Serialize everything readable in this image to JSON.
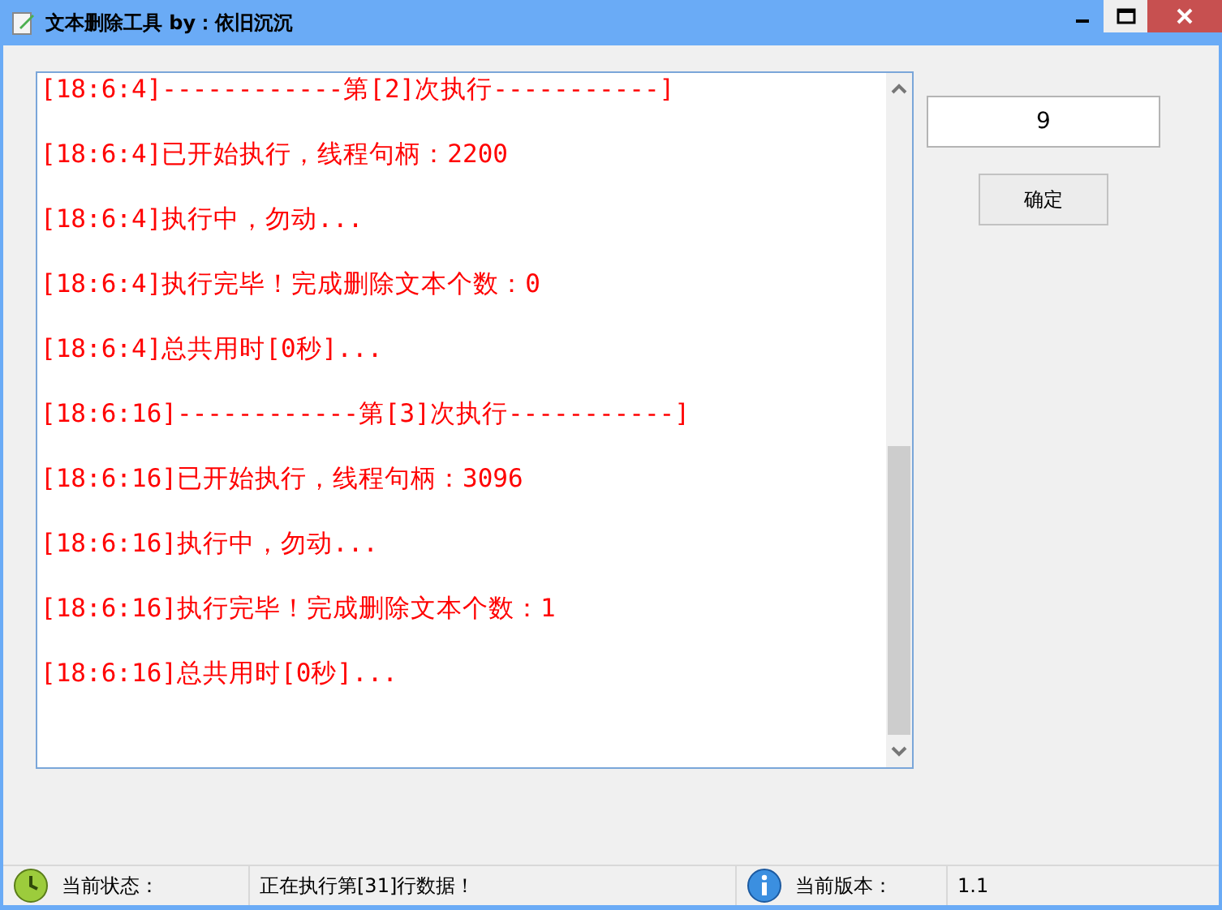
{
  "window": {
    "title": "文本删除工具 by：依旧沉沉"
  },
  "log": {
    "lines": [
      "[18:6:4]------------第[2]次执行-----------]",
      "[18:6:4]已开始执行，线程句柄：2200",
      "[18:6:4]执行中，勿动...",
      "[18:6:4]执行完毕！完成删除文本个数：0",
      "[18:6:4]总共用时[0秒]...",
      "[18:6:16]------------第[3]次执行-----------]",
      "[18:6:16]已开始执行，线程句柄：3096",
      "[18:6:16]执行中，勿动...",
      "[18:6:16]执行完毕！完成删除文本个数：1",
      "[18:6:16]总共用时[0秒]..."
    ]
  },
  "count_field": {
    "value": "9"
  },
  "confirm_button": {
    "label": "确定"
  },
  "status_bar": {
    "status_label": "当前状态：",
    "status_value": "正在执行第[31]行数据！",
    "version_label": "当前版本：",
    "version_value": "1.1"
  }
}
